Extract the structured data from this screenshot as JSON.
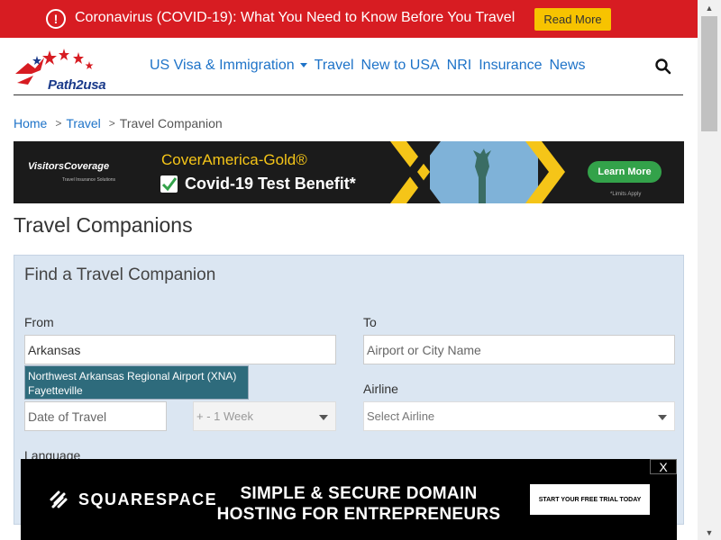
{
  "alert": {
    "icon": "info-icon",
    "text": "Coronavirus (COVID-19): What You Need to Know Before You Travel",
    "button": "Read More",
    "bg_color": "#d71c22",
    "button_color": "#f7c300"
  },
  "header": {
    "logo_text": "Path2usa",
    "nav": [
      {
        "label": "US Visa & Immigration"
      },
      {
        "label": "Travel"
      },
      {
        "label": "New to USA"
      },
      {
        "label": "NRI"
      },
      {
        "label": "Insurance"
      },
      {
        "label": "News"
      }
    ],
    "search_icon": "search-icon",
    "link_color": "#1e73c8"
  },
  "breadcrumb": {
    "home": "Home",
    "sep": ">",
    "travel": "Travel",
    "current": "Travel Companion"
  },
  "banner": {
    "brand": "VisitorsCoverage",
    "brand_sub": "Travel Insurance Solutions",
    "title": "CoverAmerica-Gold®",
    "subtitle": "Covid-19 Test Benefit*",
    "button": "Learn More",
    "note": "*Limits Apply"
  },
  "page": {
    "title": "Travel Companions"
  },
  "form": {
    "title": "Find a Travel Companion",
    "from_label": "From",
    "from_value": "Arkansas",
    "to_label": "To",
    "to_placeholder": "Airport or City Name",
    "suggestion_line1": "Northwest Arkansas Regional Airport (XNA)",
    "suggestion_line2": "Fayetteville",
    "date_placeholder": "Date of Travel",
    "range_value": "+ - 1 Week",
    "airline_label": "Airline",
    "airline_placeholder": "Select Airline",
    "language_label": "Language",
    "panel_color": "#dbe6f2"
  },
  "ad": {
    "brand": "SQUARESPACE",
    "headline_line1": "SIMPLE & SECURE DOMAIN",
    "headline_line2": "HOSTING FOR ENTREPRENEURS",
    "cta": "START YOUR FREE TRIAL TODAY",
    "close": "X"
  }
}
